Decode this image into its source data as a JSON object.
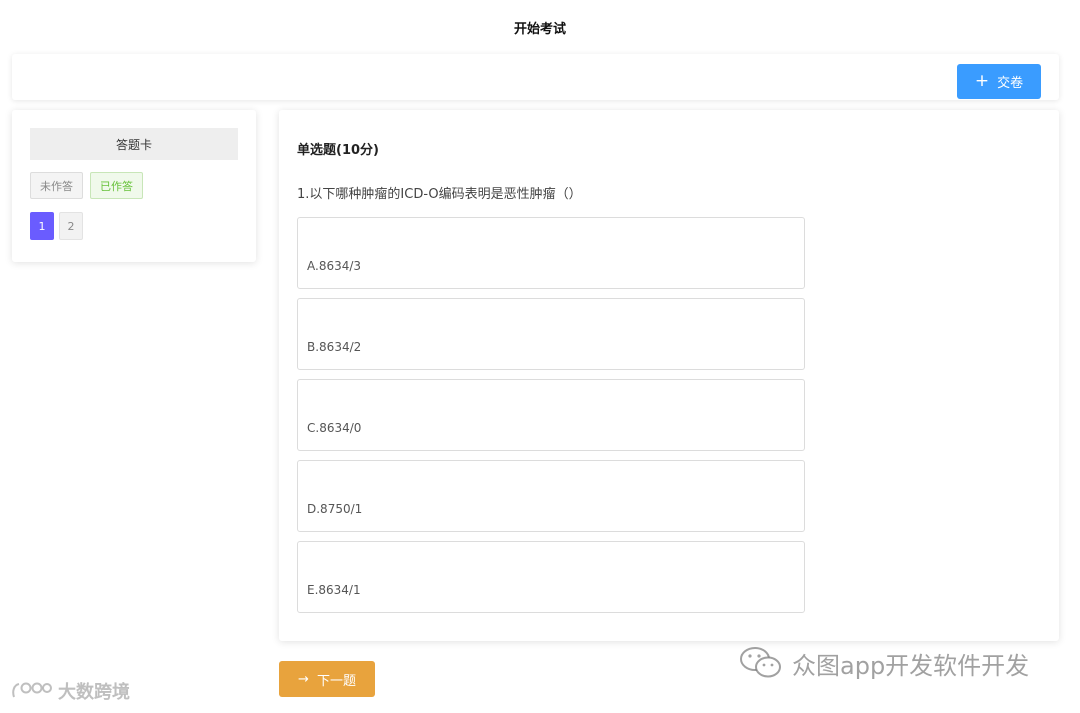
{
  "header": {
    "title": "开始考试"
  },
  "toolbar": {
    "submit_label": "交卷"
  },
  "answer_card": {
    "title": "答题卡",
    "legend_unanswered": "未作答",
    "legend_answered": "已作答",
    "question_numbers": [
      "1",
      "2"
    ],
    "active_question": "1"
  },
  "question": {
    "type_label": "单选题(10分)",
    "text": "1.以下哪种肿瘤的ICD-O编码表明是恶性肿瘤（）",
    "options": [
      {
        "label": "A.8634/3"
      },
      {
        "label": "B.8634/2"
      },
      {
        "label": "C.8634/0"
      },
      {
        "label": "D.8750/1"
      },
      {
        "label": "E.8634/1"
      }
    ]
  },
  "footer": {
    "next_label": "下一题"
  },
  "watermarks": {
    "left": "大数跨境",
    "right": "众图app开发软件开发"
  },
  "colors": {
    "submit_button": "#3a9cff",
    "next_button": "#e8a33d",
    "active_question": "#6a5cff",
    "answered_text": "#67c23a"
  }
}
